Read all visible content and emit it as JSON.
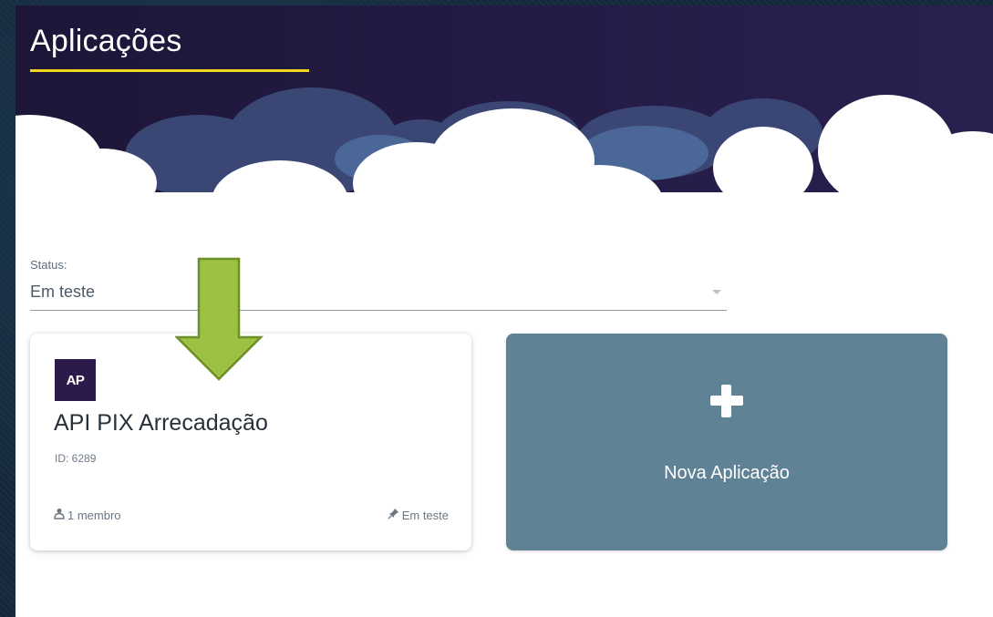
{
  "header": {
    "title": "Aplicações"
  },
  "filter": {
    "label": "Status:",
    "value": "Em teste"
  },
  "app_card": {
    "avatar": "AP",
    "name": "API PIX Arrecadação",
    "id_text": "ID: 6289",
    "members_icon": "member-icon",
    "members": "1 membro",
    "status_icon": "pin-icon",
    "status": "Em teste"
  },
  "new_app": {
    "icon": "plus-icon",
    "label": "Nova Aplicação"
  },
  "colors": {
    "header_bg": "#231b45",
    "accent_underline": "#f2d61c",
    "avatar_bg": "#2b1a4a",
    "new_card_bg": "#5f8294",
    "arrow_fill": "#9dc142"
  }
}
